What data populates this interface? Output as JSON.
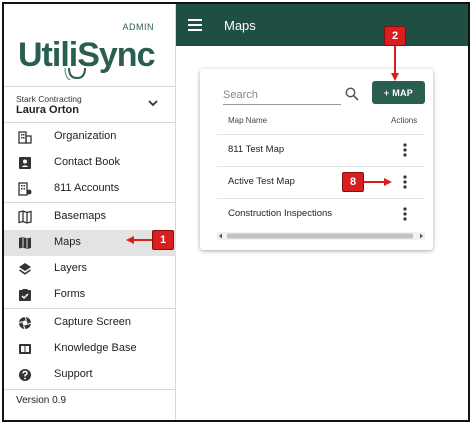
{
  "app": {
    "logo_text": "UtiliSync",
    "logo_badge": "ADMIN"
  },
  "user": {
    "organization": "Stark Contracting",
    "name": "Laura Orton"
  },
  "sidebar": {
    "items": [
      {
        "label": "Organization",
        "icon": "organization-icon"
      },
      {
        "label": "Contact Book",
        "icon": "contact-book-icon"
      },
      {
        "label": "811 Accounts",
        "icon": "accounts-icon"
      },
      {
        "label": "Basemaps",
        "icon": "basemaps-icon"
      },
      {
        "label": "Maps",
        "icon": "maps-icon",
        "active": true
      },
      {
        "label": "Layers",
        "icon": "layers-icon"
      },
      {
        "label": "Forms",
        "icon": "forms-icon"
      },
      {
        "label": "Capture Screen",
        "icon": "camera-icon"
      },
      {
        "label": "Knowledge Base",
        "icon": "book-icon"
      },
      {
        "label": "Support",
        "icon": "help-icon"
      }
    ],
    "version": "Version 0.9"
  },
  "header": {
    "title": "Maps"
  },
  "card": {
    "search_placeholder": "Search",
    "add_button": "+ MAP",
    "columns": {
      "name": "Map Name",
      "actions": "Actions"
    },
    "rows": [
      "811 Test Map",
      "Active Test Map",
      "Construction Inspections"
    ]
  },
  "callouts": {
    "one": "1",
    "two": "2",
    "eight": "8"
  },
  "colors": {
    "header": "#1f4e44",
    "button": "#2a5e50",
    "callout": "#d81e1e"
  }
}
